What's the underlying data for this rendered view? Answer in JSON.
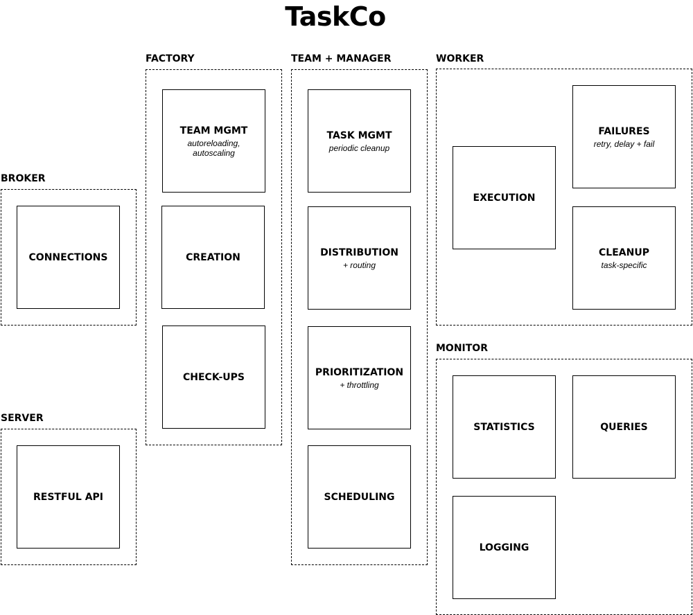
{
  "title": "TaskCo",
  "groups": {
    "broker": {
      "label": "BROKER",
      "blocks": [
        {
          "title": "CONNECTIONS",
          "subtitle": ""
        }
      ]
    },
    "server": {
      "label": "SERVER",
      "blocks": [
        {
          "title": "RESTFUL API",
          "subtitle": ""
        }
      ]
    },
    "factory": {
      "label": "FACTORY",
      "blocks": [
        {
          "title": "TEAM MGMT",
          "subtitle": "autoreloading, autoscaling"
        },
        {
          "title": "CREATION",
          "subtitle": ""
        },
        {
          "title": "CHECK-UPS",
          "subtitle": ""
        }
      ]
    },
    "team_manager": {
      "label": "TEAM + MANAGER",
      "blocks": [
        {
          "title": "TASK MGMT",
          "subtitle": "periodic cleanup"
        },
        {
          "title": "DISTRIBUTION",
          "subtitle": "+ routing"
        },
        {
          "title": "PRIORITIZATION",
          "subtitle": "+ throttling"
        },
        {
          "title": "SCHEDULING",
          "subtitle": ""
        }
      ]
    },
    "worker": {
      "label": "WORKER",
      "blocks": [
        {
          "title": "EXECUTION",
          "subtitle": ""
        },
        {
          "title": "FAILURES",
          "subtitle": "retry, delay + fail"
        },
        {
          "title": "CLEANUP",
          "subtitle": "task-specific"
        }
      ]
    },
    "monitor": {
      "label": "MONITOR",
      "blocks": [
        {
          "title": "STATISTICS",
          "subtitle": ""
        },
        {
          "title": "QUERIES",
          "subtitle": ""
        },
        {
          "title": "LOGGING",
          "subtitle": ""
        }
      ]
    }
  }
}
